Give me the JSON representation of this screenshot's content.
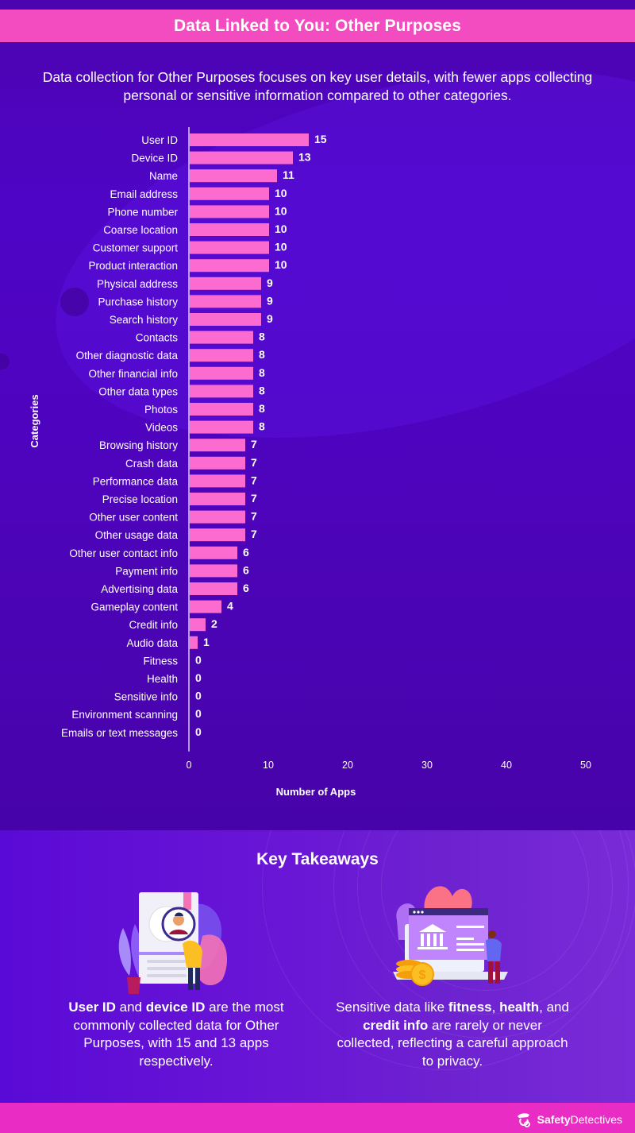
{
  "header": {
    "title": "Data Linked to You: Other Purposes",
    "subtitle": "Data collection for Other Purposes focuses on key user details, with fewer apps collecting personal or sensitive information compared to other categories."
  },
  "colors": {
    "background": "#4c04b0",
    "title_band": "#f24cc0",
    "bar": "#fb6bd0",
    "footer": "#e82cc4"
  },
  "chart_data": {
    "type": "bar",
    "orientation": "horizontal",
    "title": "Data Linked to You: Other Purposes",
    "xlabel": "Number of Apps",
    "ylabel": "Categories",
    "xlim": [
      0,
      50
    ],
    "xticks": [
      0,
      10,
      20,
      30,
      40,
      50
    ],
    "grid": false,
    "data_labels": true,
    "categories": [
      "User ID",
      "Device ID",
      "Name",
      "Email address",
      "Phone number",
      "Coarse location",
      "Customer support",
      "Product interaction",
      "Physical address",
      "Purchase history",
      "Search history",
      "Contacts",
      "Other diagnostic data",
      "Other financial info",
      "Other data types",
      "Photos",
      "Videos",
      "Browsing history",
      "Crash data",
      "Performance data",
      "Precise location",
      "Other user content",
      "Other usage data",
      "Other user contact info",
      "Payment info",
      "Advertising data",
      "Gameplay content",
      "Credit info",
      "Audio data",
      "Fitness",
      "Health",
      "Sensitive info",
      "Environment scanning",
      "Emails or text messages"
    ],
    "values": [
      15,
      13,
      11,
      10,
      10,
      10,
      10,
      10,
      9,
      9,
      9,
      8,
      8,
      8,
      8,
      8,
      8,
      7,
      7,
      7,
      7,
      7,
      7,
      6,
      6,
      6,
      4,
      2,
      1,
      0,
      0,
      0,
      0,
      0
    ]
  },
  "takeaways": {
    "title": "Key Takeaways",
    "items": [
      {
        "illustration": "person-with-magnifier-profile-illustration",
        "segments": [
          {
            "text": "User ID",
            "bold": true
          },
          {
            "text": " and ",
            "bold": false
          },
          {
            "text": "device ID",
            "bold": true
          },
          {
            "text": " are the most commonly collected data for Other Purposes, with 15 and 13 apps respectively.",
            "bold": false
          }
        ]
      },
      {
        "illustration": "bank-laptop-coins-illustration",
        "segments": [
          {
            "text": "Sensitive data like ",
            "bold": false
          },
          {
            "text": "fitness",
            "bold": true
          },
          {
            "text": ", ",
            "bold": false
          },
          {
            "text": "health",
            "bold": true
          },
          {
            "text": ", and ",
            "bold": false
          },
          {
            "text": "credit info",
            "bold": true
          },
          {
            "text": " are rarely or never collected, reflecting a careful approach to privacy.",
            "bold": false
          }
        ]
      }
    ]
  },
  "footer": {
    "brand_bold": "Safety",
    "brand_regular": "Detectives",
    "logo_icon": "detective-hat-logo-icon"
  }
}
